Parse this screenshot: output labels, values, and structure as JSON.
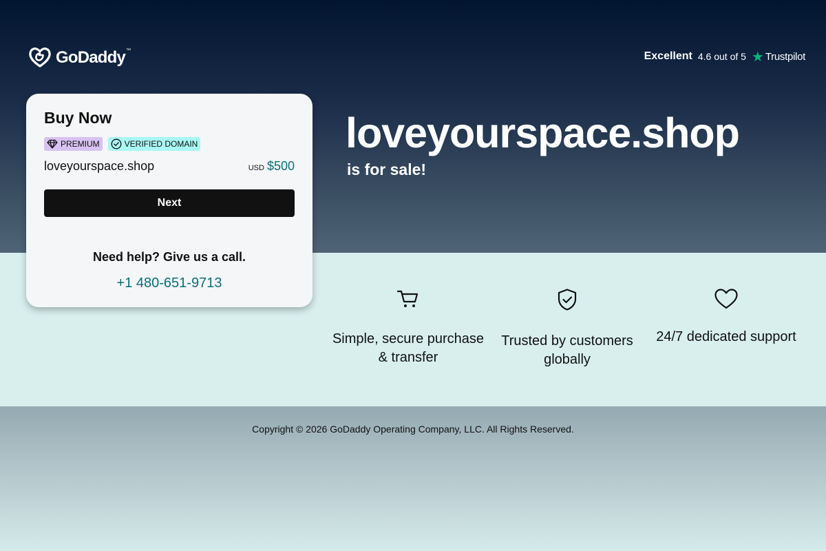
{
  "header": {
    "logo_text": "GoDaddy",
    "trust": {
      "rating_label": "Excellent",
      "score_text": "4.6 out of 5",
      "brand": "Trustpilot",
      "star_icon": "star-icon",
      "star_color": "#00b67a"
    }
  },
  "hero": {
    "domain": "loveyourspace.shop",
    "subtitle": "is for sale!"
  },
  "card": {
    "title": "Buy Now",
    "badges": [
      {
        "label": "PREMIUM",
        "icon": "diamond-icon",
        "color": "#d7c2f2"
      },
      {
        "label": "VERIFIED DOMAIN",
        "icon": "check-circle-icon",
        "color": "#a9f7f4"
      }
    ],
    "domain": "loveyourspace.shop",
    "currency": "USD",
    "price": "$500",
    "next_label": "Next",
    "help_text": "Need help? Give us a call.",
    "phone": "+1 480-651-9713"
  },
  "features": [
    {
      "icon": "cart-icon",
      "label": "Simple, secure purchase & transfer"
    },
    {
      "icon": "shield-check-icon",
      "label": "Trusted by customers globally"
    },
    {
      "icon": "heart-icon",
      "label": "24/7 dedicated support"
    }
  ],
  "footer": {
    "copyright": "Copyright © 2026 GoDaddy Operating Company, LLC. All Rights Reserved."
  },
  "colors": {
    "accent": "#0b6e79",
    "button": "#111111"
  }
}
